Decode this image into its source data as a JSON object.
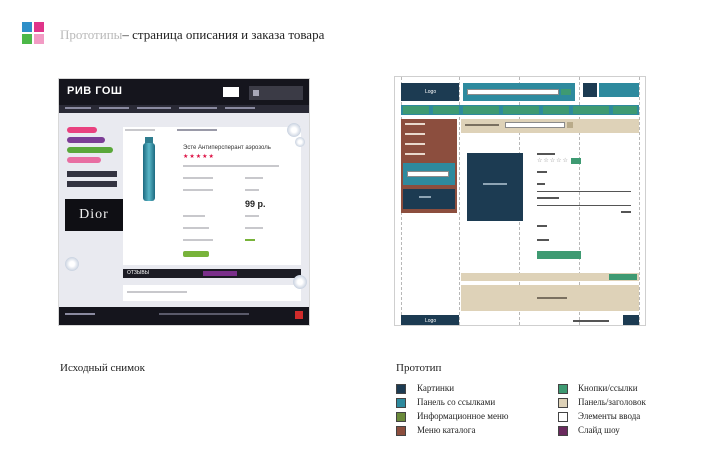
{
  "title": {
    "part1": "Прототипы",
    "part2": "– страница описания и заказа товара"
  },
  "brand_squares": [
    "#2e8fc8",
    "#e0348a",
    "#4cb848",
    "#f29bc4"
  ],
  "source_screenshot": {
    "logo": "РИВ ГОШ",
    "brand": "Dior",
    "product_title": "Эсте Антиперсперант аэрозоль",
    "stars": "★★★★★",
    "price": "99 р.",
    "tab_label": "ОТЗЫВЫ",
    "left_pills": [
      "#e9417f",
      "#7c3d96",
      "#5aa83a",
      "#e86ea2"
    ]
  },
  "prototype": {
    "logo_label": "Logo",
    "header_button": "",
    "photo_label": "Photo slider",
    "buy_label": "",
    "footer_logo": "Logo",
    "checkout_label": "Checkout"
  },
  "captions": {
    "left": "Исходный снимок",
    "right": "Прототип"
  },
  "legend": [
    {
      "label": "Картинки",
      "color": "#1c3b52"
    },
    {
      "label": "Панель со ссылками",
      "color": "#2e8a9e"
    },
    {
      "label": "Информационное меню",
      "color": "#6a8a3a"
    },
    {
      "label": "Меню каталога",
      "color": "#8c4e3e"
    },
    {
      "label": "Кнопки/ссылки",
      "color": "#3e9a72"
    },
    {
      "label": "Панель/заголовок",
      "color": "#ded2b8"
    },
    {
      "label": "Элементы ввода",
      "color": "#ffffff"
    },
    {
      "label": "Слайд шоу",
      "color": "#6a2a5e"
    }
  ]
}
